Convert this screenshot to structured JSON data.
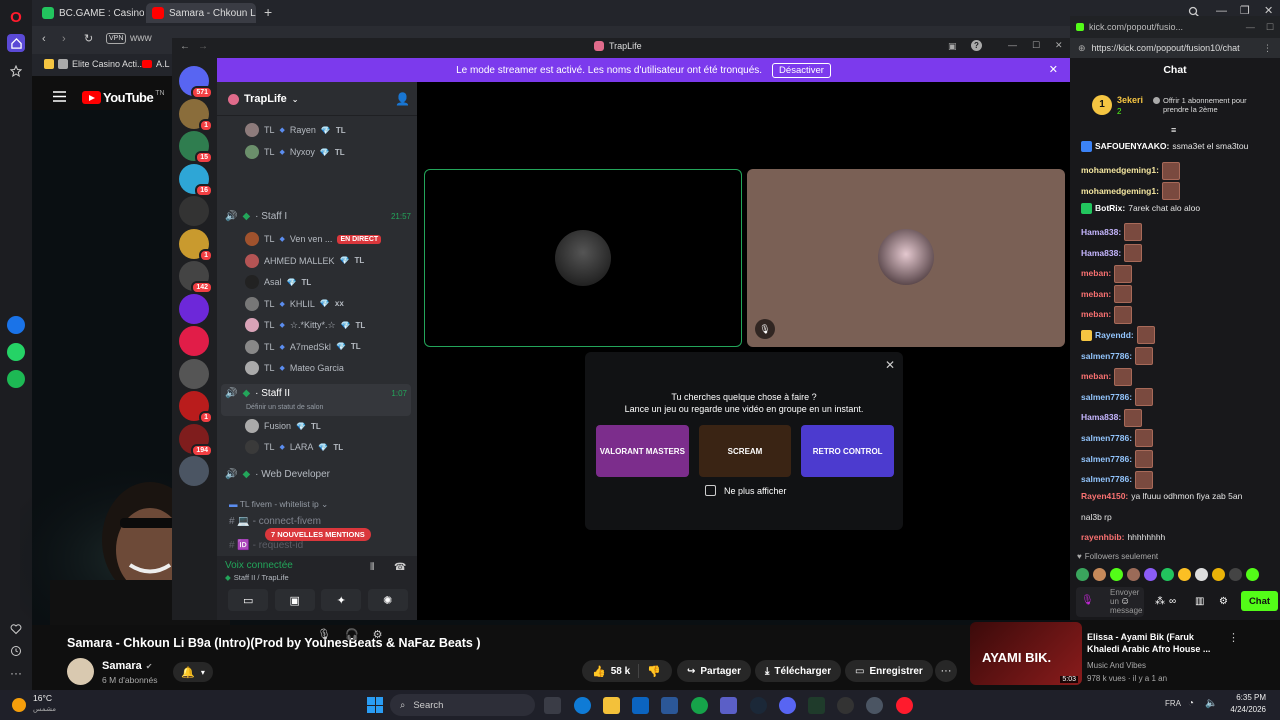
{
  "browser": {
    "tabs": [
      {
        "label": "BC.GAME : Casino Crypto",
        "color": "#22c55e"
      },
      {
        "label": "Samara - Chkoun Li B9a (I",
        "color": "#ff0000"
      }
    ],
    "address_prefix": "www",
    "vpn": "VPN",
    "bookmarks": [
      {
        "label": "Elite Casino Acti...",
        "color": "#f5c542"
      },
      {
        "label": "A.L",
        "color": "#ff0000"
      }
    ]
  },
  "youtube": {
    "logo_text": "YouTube",
    "country": "TN",
    "video_title": "Samara - Chkoun Li B9a (Intro)(Prod by YounesBeats & NaFaz Beats )",
    "channel_name": "Samara",
    "subscribers": "6 M d'abonnés",
    "likes": "58 k",
    "share_label": "Partager",
    "download_label": "Télécharger",
    "save_label": "Enregistrer",
    "reco": {
      "title": "Elissa - Ayami Bik (Faruk Khaledi Arabic Afro House ...",
      "channel": "Music And Vibes",
      "meta": "978 k vues · il y a 1 an",
      "thumb_text": "AYAMI BIK.",
      "duration": "5:03"
    }
  },
  "discord": {
    "window_title": "TrapLife",
    "banner_text": "Le mode streamer est activé. Les noms d'utilisateur ont été tronqués.",
    "banner_button": "Désactiver",
    "server_name": "TrapLife",
    "servers": [
      {
        "badge": "571",
        "color": "#5865f2"
      },
      {
        "badge": "1",
        "color": "#8a6d3b"
      },
      {
        "badge": "15",
        "color": "#2f7d4f"
      },
      {
        "badge": "16",
        "color": "#2ea6d6"
      },
      {
        "badge": "",
        "color": "#333333"
      },
      {
        "badge": "1",
        "color": "#c99a2e"
      },
      {
        "badge": "142",
        "color": "#444444"
      },
      {
        "badge": "",
        "color": "#6d28d9"
      },
      {
        "badge": "",
        "color": "#e11d48"
      },
      {
        "badge": "",
        "color": "#555555"
      },
      {
        "badge": "1",
        "color": "#b91c1c"
      },
      {
        "badge": "194",
        "color": "#7f1d1d"
      },
      {
        "badge": "",
        "color": "#4b5563"
      }
    ],
    "members_top": [
      {
        "tl": "TL",
        "name": "Rayen",
        "tag": "TL"
      },
      {
        "tl": "TL",
        "name": "Nyxoy",
        "tag": "TL"
      }
    ],
    "staff1": {
      "name": "Staff I",
      "time": "21:57"
    },
    "staff1_members": [
      {
        "tl": "TL",
        "name": "Ven ven ...",
        "tag": "",
        "live": "EN DIRECT"
      },
      {
        "tl": "",
        "name": "AHMED MALLEK",
        "tag": "TL"
      },
      {
        "tl": "",
        "name": "Asal",
        "tag": "TL"
      },
      {
        "tl": "TL",
        "name": "KHLIL",
        "tag": "xx"
      },
      {
        "tl": "TL",
        "name": "☆.*Kitty*.☆",
        "tag": "TL"
      },
      {
        "tl": "TL",
        "name": "A7medSkl",
        "tag": "TL"
      },
      {
        "tl": "TL",
        "name": "Mateo Garcia",
        "tag": ""
      }
    ],
    "staff2": {
      "name": "Staff II",
      "time": "1:07",
      "status": "Définir un statut de salon"
    },
    "staff2_members": [
      {
        "tl": "",
        "name": "Fusion",
        "tag": "TL"
      },
      {
        "tl": "TL",
        "name": "LARA",
        "tag": "TL"
      }
    ],
    "web_dev": "Web Developer",
    "category": "TL fivem - whitelist ip",
    "channel_connect": "connect-fivem",
    "channel_request": "request-id",
    "mentions_pill": "7 NOUVELLES MENTIONS",
    "voice_status": "Voix connectée",
    "voice_channel": "Staff II / TrapLife",
    "activity_title": "Tu cherches quelque chose à faire ?",
    "activity_sub": "Lance un jeu ou regarde une vidéo en groupe en un instant.",
    "activities": [
      {
        "label": "VALORANT MASTERS",
        "color": "#7c2d8c"
      },
      {
        "label": "SCREAM",
        "color": "#3a2414"
      },
      {
        "label": "RETRO CONTROL",
        "color": "#4c3bcf"
      }
    ],
    "dont_show": "Ne plus afficher"
  },
  "kick": {
    "window_title": "kick.com/popout/fusio...",
    "url": "https://kick.com/popout/fusion10/chat",
    "header": "Chat",
    "pinned_user": "3ekeri",
    "pinned_count": "2",
    "pinned_offer": "Offrir 1 abonnement pour prendre la 2ème",
    "messages": [
      {
        "user": "SAFOUENYAAKO:",
        "text": "ssma3et el sma3tou",
        "color": "#ffffff",
        "emote": false,
        "badge": "verified"
      },
      {
        "user": "mohamedgeming1:",
        "text": "",
        "color": "#f5e7a0",
        "emote": true,
        "badge": ""
      },
      {
        "user": "mohamedgeming1:",
        "text": "",
        "color": "#f5e7a0",
        "emote": true,
        "badge": ""
      },
      {
        "user": "BotRix:",
        "text": "7arek chat alo aloo",
        "color": "#ffffff",
        "emote": false,
        "badge": "bot"
      },
      {
        "user": "Hama838:",
        "text": "",
        "color": "#c4b5fd",
        "emote": true,
        "badge": ""
      },
      {
        "user": "Hama838:",
        "text": "",
        "color": "#c4b5fd",
        "emote": true,
        "badge": ""
      },
      {
        "user": "meban:",
        "text": "",
        "color": "#f87171",
        "emote": true,
        "badge": ""
      },
      {
        "user": "meban:",
        "text": "",
        "color": "#f87171",
        "emote": true,
        "badge": ""
      },
      {
        "user": "meban:",
        "text": "",
        "color": "#f87171",
        "emote": true,
        "badge": ""
      },
      {
        "user": "Rayendd:",
        "text": "",
        "color": "#93c5fd",
        "emote": true,
        "badge": "crown"
      },
      {
        "user": "salmen7786:",
        "text": "",
        "color": "#93c5fd",
        "emote": true,
        "badge": ""
      },
      {
        "user": "meban:",
        "text": "",
        "color": "#f87171",
        "emote": true,
        "badge": ""
      },
      {
        "user": "salmen7786:",
        "text": "",
        "color": "#93c5fd",
        "emote": true,
        "badge": ""
      },
      {
        "user": "Hama838:",
        "text": "",
        "color": "#c4b5fd",
        "emote": true,
        "badge": ""
      },
      {
        "user": "salmen7786:",
        "text": "",
        "color": "#93c5fd",
        "emote": true,
        "badge": ""
      },
      {
        "user": "salmen7786:",
        "text": "",
        "color": "#93c5fd",
        "emote": true,
        "badge": ""
      },
      {
        "user": "salmen7786:",
        "text": "",
        "color": "#93c5fd",
        "emote": true,
        "badge": ""
      },
      {
        "user": "Rayen4150:",
        "text": "ya lfuuu odhmon fiya zab 5an",
        "color": "#f87171",
        "emote": false,
        "badge": ""
      },
      {
        "user": "",
        "text": "nal3b rp",
        "color": "#ffffff",
        "emote": false,
        "badge": ""
      },
      {
        "user": "rayenhbib:",
        "text": "hhhhhhhh",
        "color": "#f87171",
        "emote": false,
        "badge": ""
      }
    ],
    "followers_only": "Followers seulement",
    "input_placeholder": "Envoyer un message",
    "chat_button": "Chat"
  },
  "taskbar": {
    "weather_temp": "16°C",
    "weather_desc": "مشمس",
    "search_placeholder": "Search",
    "lang": "FRA",
    "time": "6:35 PM",
    "date": "4/24/2026"
  }
}
